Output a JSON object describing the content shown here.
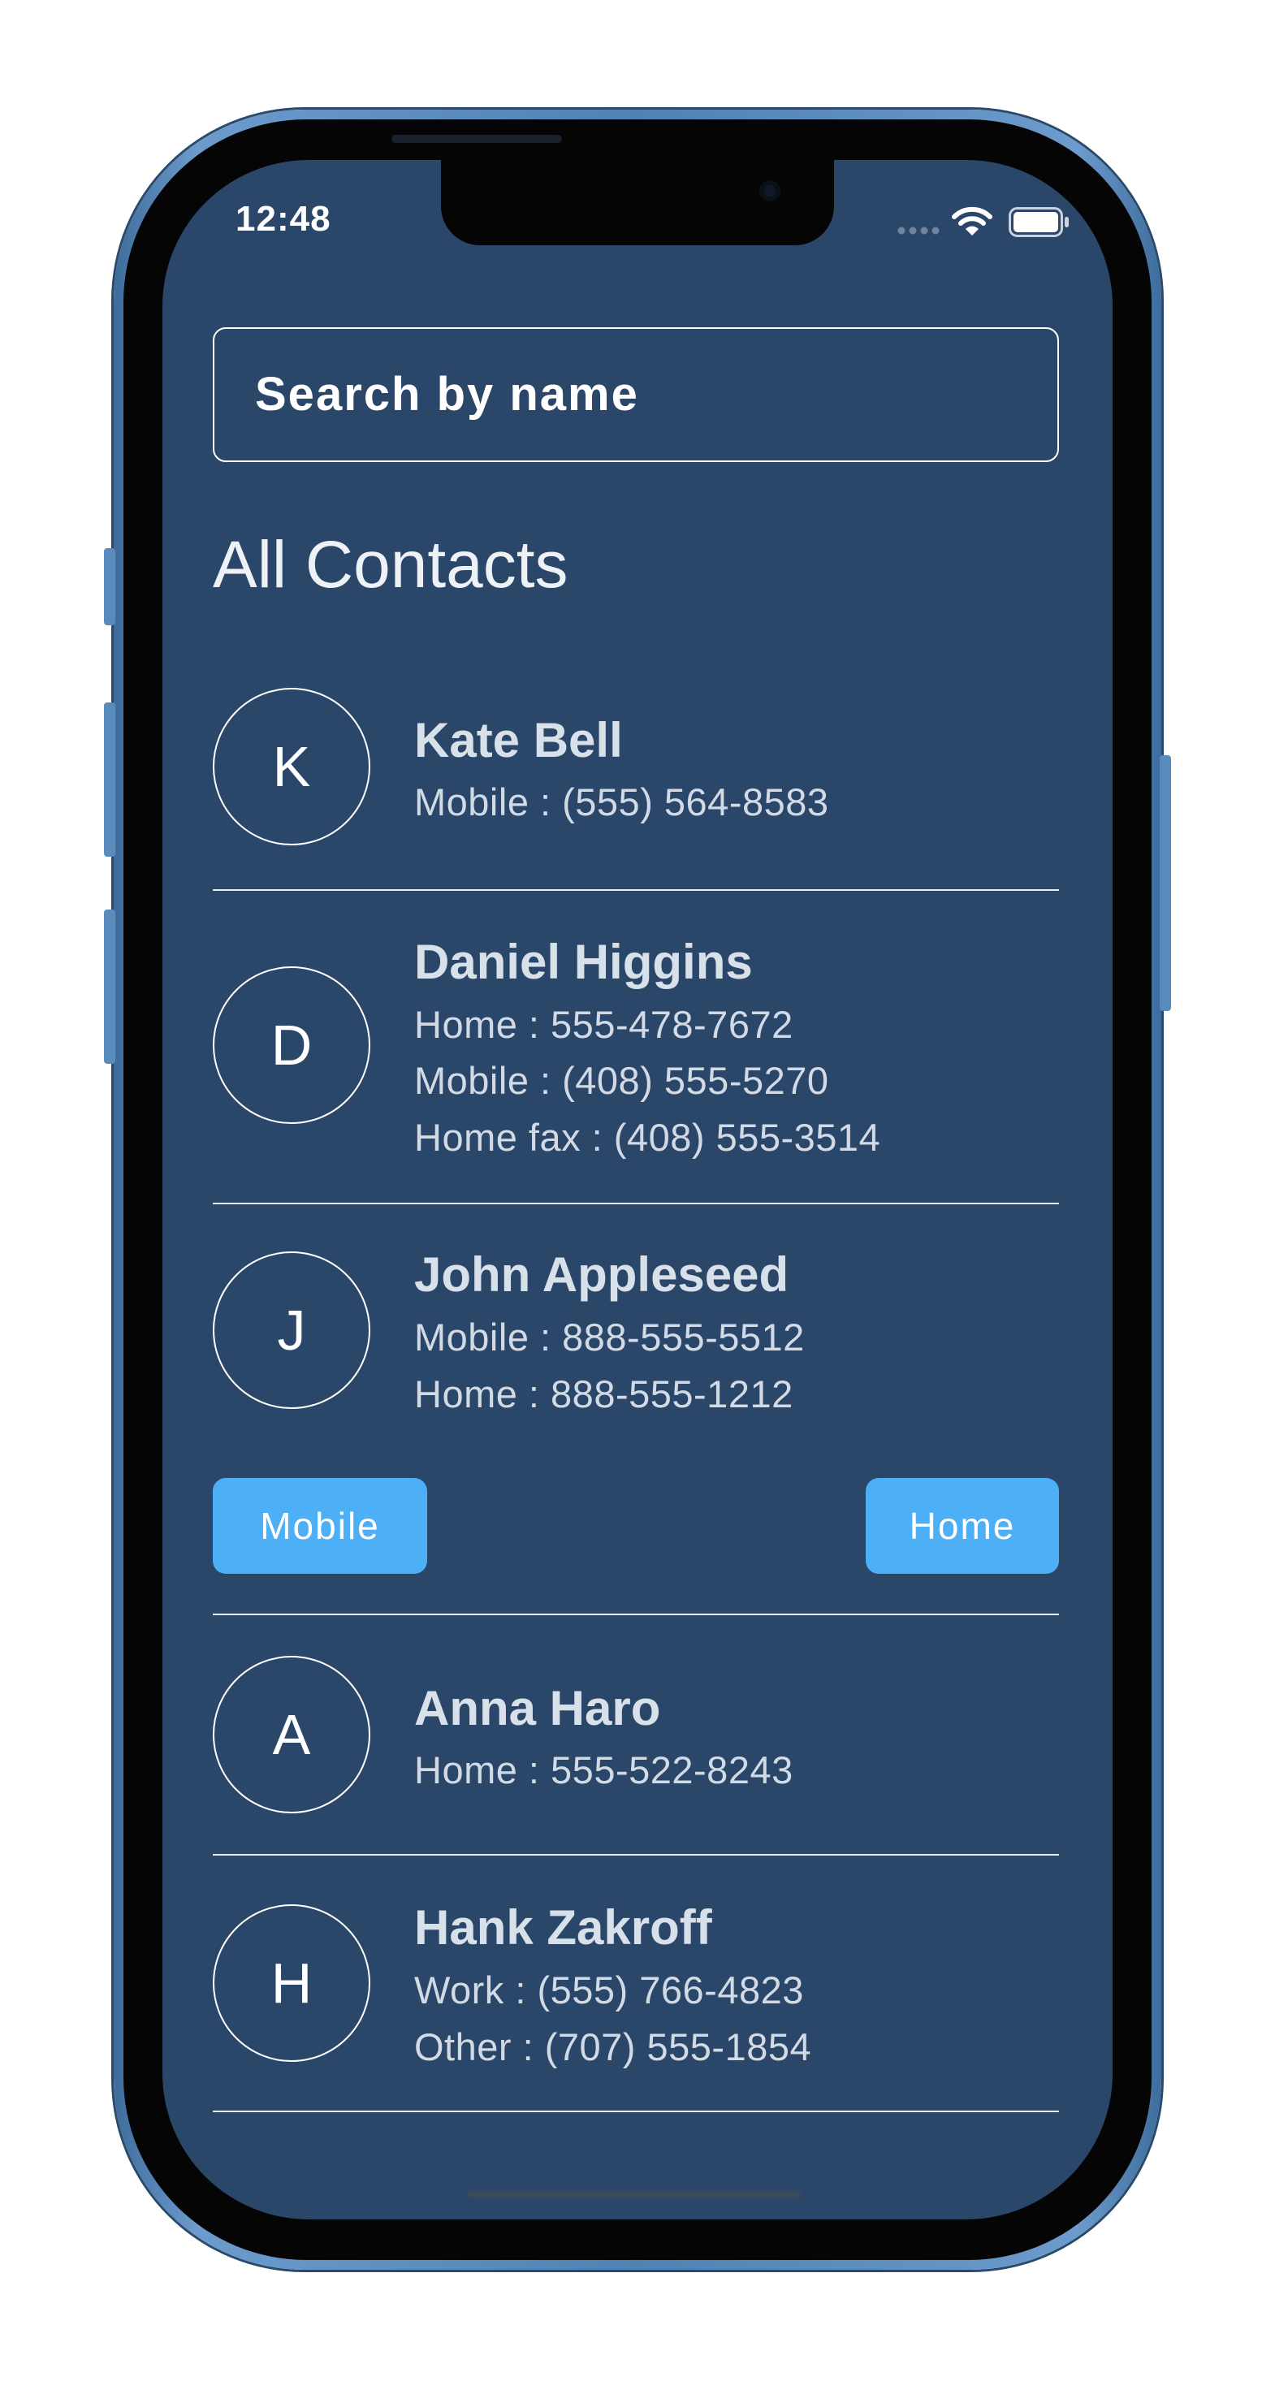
{
  "status_bar": {
    "time": "12:48"
  },
  "search": {
    "placeholder": "Search by name"
  },
  "section_title": "All Contacts",
  "contacts": [
    {
      "initial": "K",
      "name": "Kate Bell",
      "phones": [
        "Mobile : (555) 564-8583"
      ]
    },
    {
      "initial": "D",
      "name": "Daniel Higgins",
      "phones": [
        "Home : 555-478-7672",
        "Mobile : (408) 555-5270",
        "Home fax : (408) 555-3514"
      ]
    },
    {
      "initial": "J",
      "name": "John Appleseed",
      "phones": [
        "Mobile : 888-555-5512",
        "Home : 888-555-1212"
      ]
    },
    {
      "initial": "A",
      "name": "Anna Haro",
      "phones": [
        "Home : 555-522-8243"
      ]
    },
    {
      "initial": "H",
      "name": "Hank Zakroff",
      "phones": [
        "Work : (555) 766-4823",
        "Other : (707) 555-1854"
      ]
    }
  ],
  "actions": {
    "mobile_label": "Mobile",
    "home_label": "Home"
  },
  "colors": {
    "screen_background": "#2a4669",
    "action_button": "#4db0f7",
    "phone_frame": "#4f81b4"
  }
}
